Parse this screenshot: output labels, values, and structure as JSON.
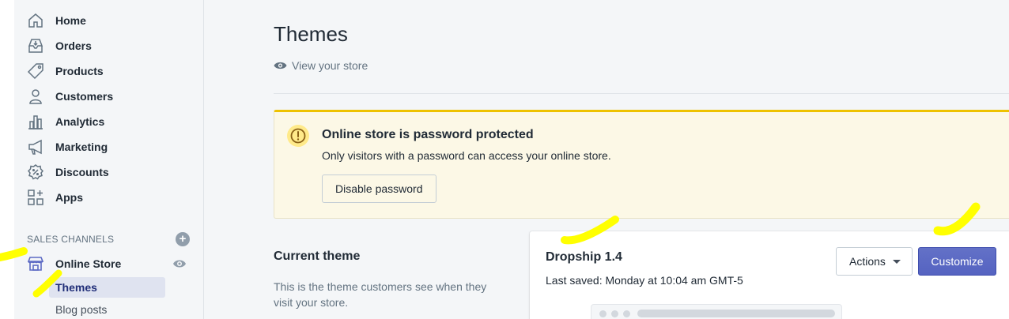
{
  "sidebar": {
    "nav_items": [
      {
        "label": "Home",
        "icon": "home-icon"
      },
      {
        "label": "Orders",
        "icon": "orders-icon"
      },
      {
        "label": "Products",
        "icon": "tag-icon"
      },
      {
        "label": "Customers",
        "icon": "person-icon"
      },
      {
        "label": "Analytics",
        "icon": "bar-chart-icon"
      },
      {
        "label": "Marketing",
        "icon": "megaphone-icon"
      },
      {
        "label": "Discounts",
        "icon": "discount-icon"
      },
      {
        "label": "Apps",
        "icon": "apps-icon"
      }
    ],
    "sales_channels_title": "SALES CHANNELS",
    "online_store_label": "Online Store",
    "sub_items": [
      {
        "label": "Themes",
        "active": true
      },
      {
        "label": "Blog posts",
        "active": false
      }
    ]
  },
  "main": {
    "title": "Themes",
    "view_store_label": "View your store",
    "banner": {
      "title": "Online store is password protected",
      "text": "Only visitors with a password can access your online store.",
      "button_label": "Disable password"
    },
    "current_theme": {
      "title": "Current theme",
      "description": "This is the theme customers see when they visit your store."
    },
    "theme_card": {
      "name": "Dropship 1.4",
      "last_saved": "Last saved: Monday at 10:04 am GMT-5",
      "actions_label": "Actions",
      "customize_label": "Customize"
    }
  },
  "colors": {
    "accent": "#5c6ac4",
    "warning_border": "#eec200",
    "warning_bg": "#fcf8e6",
    "annotation_highlight": "#ffff00"
  }
}
